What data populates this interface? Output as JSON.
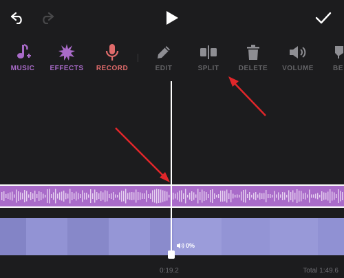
{
  "colors": {
    "background": "#1c1c1e",
    "purple": "#a96bc9",
    "record_red": "#e06b6b",
    "inactive": "#8e8e93",
    "video": "#8e8fd2",
    "annotation_red": "#e0262a"
  },
  "topbar": {
    "undo_icon": "undo-icon",
    "redo_icon": "redo-icon",
    "play_icon": "play-icon",
    "done_icon": "checkmark-icon"
  },
  "tools": [
    {
      "label": "MUSIC",
      "icon": "music-note-plus-icon"
    },
    {
      "label": "EFFECTS",
      "icon": "starburst-icon"
    },
    {
      "label": "RECORD",
      "icon": "microphone-icon"
    },
    {
      "label": "EDIT",
      "icon": "pencil-icon"
    },
    {
      "label": "SPLIT",
      "icon": "split-icon"
    },
    {
      "label": "DELETE",
      "icon": "trash-icon"
    },
    {
      "label": "VOLUME",
      "icon": "speaker-icon"
    },
    {
      "label": "BE",
      "icon": "partial-icon"
    }
  ],
  "timeline": {
    "volume_badge": "0%",
    "current_time": "0:19.2",
    "total_time": "Total 1:49.6"
  }
}
